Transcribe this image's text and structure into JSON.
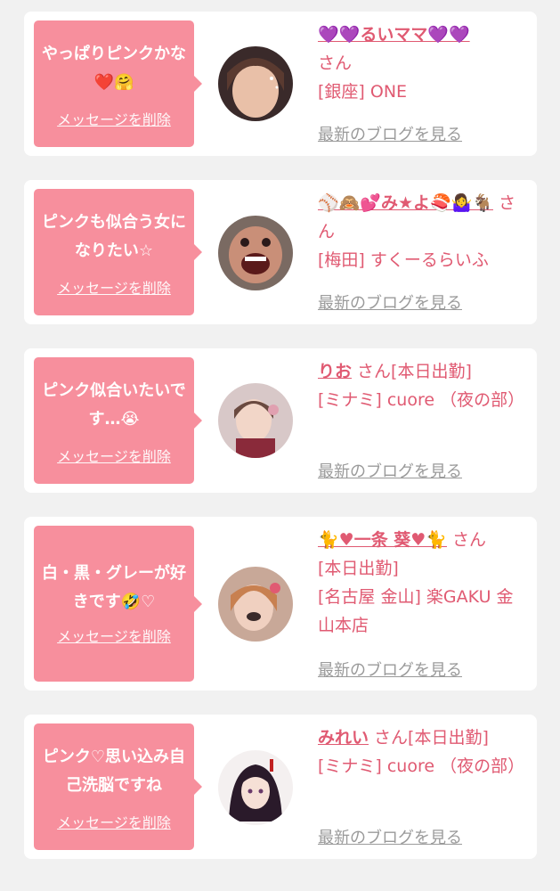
{
  "delete_label": "メッセージを削除",
  "blog_label": "最新のブログを見る",
  "honorific": "さん",
  "colors": {
    "bubble": "#f78f9d",
    "accent": "#e05a72",
    "muted": "#9a9a9a",
    "background": "#f1f1f1"
  },
  "items": [
    {
      "message": "やっぱりピンクかな❤️🤗",
      "name": "💜💜るいママ💜💜",
      "status": "",
      "store": "[銀座] ONE"
    },
    {
      "message": "ピンクも似合う女になりたい☆",
      "name": "⚾🙈💕み★よ🍣🤷‍♀️🐐",
      "status": "",
      "store": "[梅田] すくーるらいふ"
    },
    {
      "message": "ピンク似合いたいです…😭",
      "name": "りお",
      "status": "[本日出勤]",
      "store": "[ミナミ] cuore （夜の部）"
    },
    {
      "message": "白・黒・グレーが好きです🤣♡",
      "name": "🐈♥一条 葵♥🐈",
      "status": "[本日出勤]",
      "store": "[名古屋 金山] 楽GAKU 金山本店"
    },
    {
      "message": "ピンク♡思い込み自己洗脳ですね",
      "name": "みれい",
      "status": "[本日出勤]",
      "store": "[ミナミ] cuore （夜の部）"
    }
  ]
}
